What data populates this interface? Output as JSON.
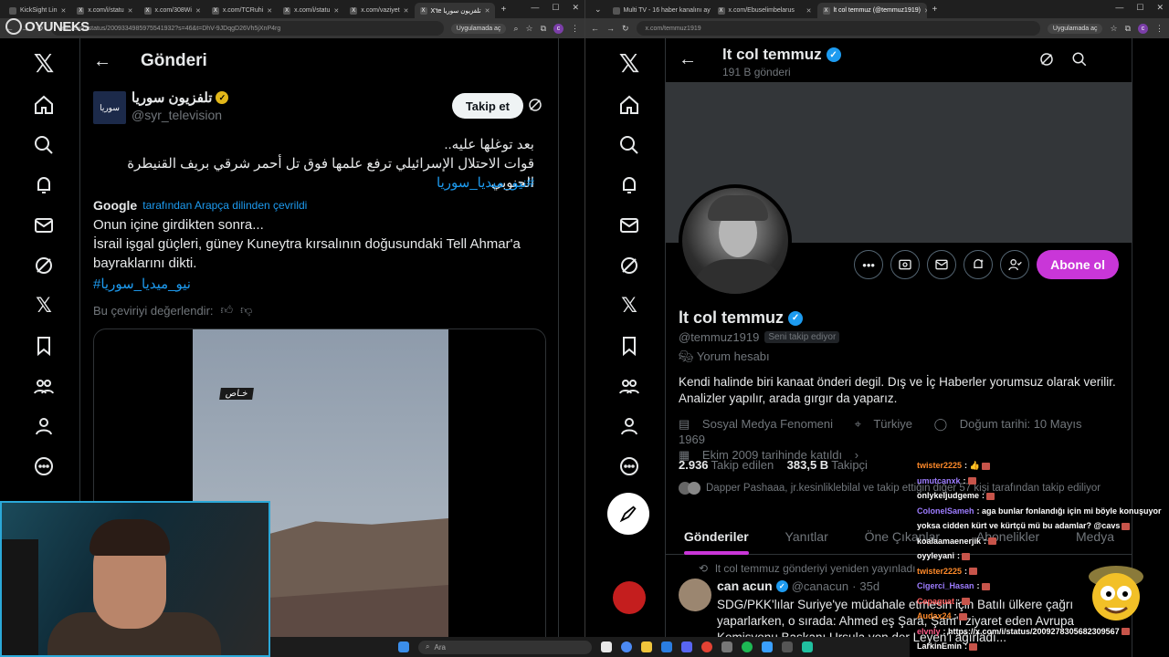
{
  "brand": {
    "name": "OYUNEKS"
  },
  "left_window": {
    "tabs": [
      {
        "label": "KickSight Lin",
        "active": false
      },
      {
        "label": "x.com/i/statu",
        "active": false
      },
      {
        "label": "x.com/308Wi",
        "active": false
      },
      {
        "label": "x.com/TCRuhi",
        "active": false
      },
      {
        "label": "x.com/i/statu",
        "active": false
      },
      {
        "label": "x.com/vaziyet",
        "active": false
      },
      {
        "label": "X'te تلفزيون سوريا",
        "active": true
      }
    ],
    "url": "television/status/2009334985975541932?s=46&t=DhV-9JDqgD26Vh5jXnP4rg",
    "app_open_label": "Uygulamada aç",
    "header_title": "Gönderi",
    "author": {
      "name": "تلفزيون سوريا",
      "handle": "@syr_television",
      "avatar_text": "سوريا"
    },
    "follow_label": "Takip et",
    "tweet_ar_line1": "بعد توغلها عليه..",
    "tweet_ar_line2": "قوات الاحتلال الإسرائيلي ترفع علمها فوق تل أحمر شرقي بريف القنيطرة الجنوبي",
    "tweet_ar_hashtag": "#نيو_ميديا_سوريا",
    "translate_brand": "Google",
    "translate_label": "tarafından Arapça dilinden çevrildi",
    "tr_line1": "Onun içine girdikten sonra...",
    "tr_line2": "İsrail işgal güçleri, güney Kuneytra kırsalının doğusundaki Tell Ahmar'a bayraklarını dikti.",
    "tr_hashtag": "#نيو_ميديا_سوريا",
    "rate_label": "Bu çeviriyi değerlendir:",
    "media_caption": "خـاص"
  },
  "right_window": {
    "tabs": [
      {
        "label": "Multi TV - 16 haber kanalını ay",
        "active": false
      },
      {
        "label": "x.com/Ebuselimbelarus",
        "active": false
      },
      {
        "label": "lt col temmuz (@temmuz1919)",
        "active": true
      }
    ],
    "url": "x.com/temmuz1919",
    "app_open_label": "Uygulamada aç",
    "profile": {
      "name": "lt col temmuz",
      "post_count": "191 B gönderi",
      "handle": "@temmuz1919",
      "follows_you": "Seni takip ediyor",
      "account_type": "Yorum hesabı",
      "bio": "Kendi halinde biri  kanaat önderi degil. Dış ve İç Haberler yorumsuz olarak verilir. Analizler yapılır, arada gırgır da yaparız.",
      "category": "Sosyal Medya Fenomeni",
      "location": "Türkiye",
      "birth": "Doğum tarihi: 10 Mayıs 1969",
      "joined": "Ekim 2009 tarihinde katıldı",
      "following_count": "2.936",
      "following_label": "Takip edilen",
      "followers_count": "383,5 B",
      "followers_label": "Takipçi",
      "followed_by": "Dapper Pashaaa, jr.kesinliklebilal ve takip ettiğin diğer 57 kişi tarafından takip ediliyor"
    },
    "subscribe_label": "Abone ol",
    "tabs_profile": [
      "Gönderiler",
      "Yanıtlar",
      "Öne Çıkanlar",
      "Abonelikler",
      "Medya"
    ],
    "repost_line": "lt col temmuz gönderiyi yeniden yayınladı",
    "tweet": {
      "name": "can acun",
      "handle": "@canacun",
      "age": "35d",
      "text": "SDG/PKK'lılar Suriye'ye müdahale etmesin için Batılı ülkere çağrı yaparlarken, o sırada: Ahmed eş Şara, Şam'ı ziyaret eden Avrupa Komisyonu Başkanı Ursula von der Leyen'i ağırladı..."
    }
  },
  "chat": [
    {
      "user": "twister2225",
      "text": ": 👍",
      "color": "#ff8a2a"
    },
    {
      "user": "umutcanxk",
      "text": ":",
      "color": "#9d7cff"
    },
    {
      "user": "onlykeljudgeme",
      "text": ":",
      "color": "#ffffff"
    },
    {
      "user": "ColonelSameh",
      "text": ": aga bunlar fonlandığı için mi böyle konuşuyor yoksa cidden kürt ve kürtçü mü bu adamlar? @cavs",
      "color": "#9d7cff"
    },
    {
      "user": "koalaamaenerjik",
      "text": ":",
      "color": "#ffffff"
    },
    {
      "user": "oyyleyani",
      "text": ":",
      "color": "#ffffff"
    },
    {
      "user": "twister2225",
      "text": ":",
      "color": "#ff8a2a"
    },
    {
      "user": "Cigerci_Hasan",
      "text": ":",
      "color": "#9d7cff"
    },
    {
      "user": "Cepaguat",
      "text": ":",
      "color": "#ff5c5c"
    },
    {
      "user": "Audax24",
      "text": ":",
      "color": "#ff8a2a"
    },
    {
      "user": "elvnly",
      "text": ": https://x.com/i/status/2009278305682309567",
      "color": "#ff5c8a"
    },
    {
      "user": "LarkinEmin",
      "text": ":",
      "color": "#ffffff"
    }
  ],
  "taskbar": {
    "search_placeholder": "Ara"
  }
}
